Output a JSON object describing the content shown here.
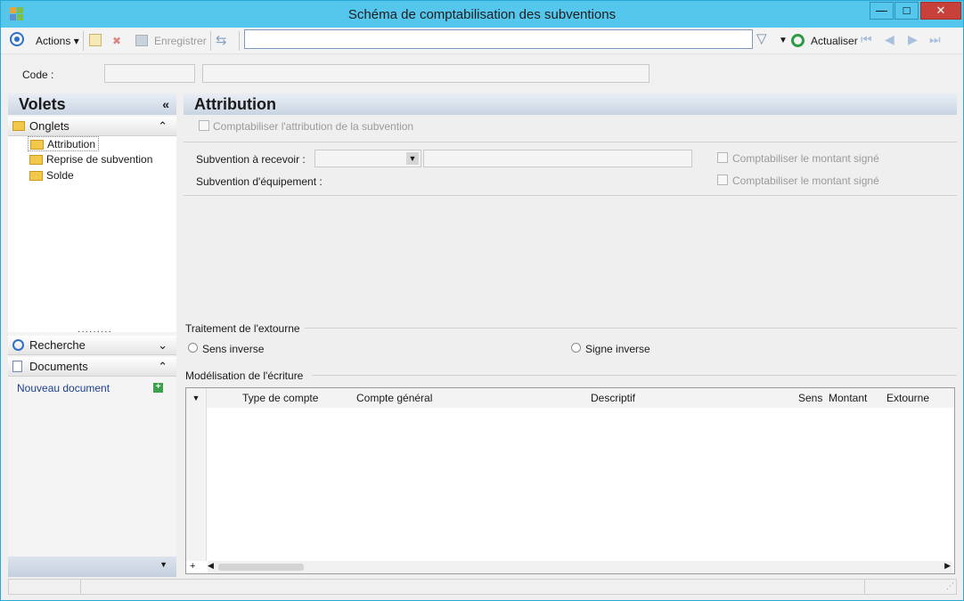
{
  "window": {
    "title": "Schéma de comptabilisation des subventions"
  },
  "toolbar": {
    "actions_label": "Actions",
    "save_label": "Enregistrer",
    "search_value": "",
    "refresh_label": "Actualiser"
  },
  "code": {
    "label": "Code :",
    "value": "",
    "description": ""
  },
  "left": {
    "title": "Volets",
    "tabs_group": "Onglets",
    "tabs": [
      "Attribution",
      "Reprise de subvention",
      "Solde"
    ],
    "search_group": "Recherche",
    "documents_group": "Documents",
    "new_document": "Nouveau document"
  },
  "main": {
    "title": "Attribution",
    "post_attribution_label": "Comptabiliser l'attribution de la subvention",
    "subsidy_receivable_label": "Subvention à recevoir :",
    "subsidy_equipment_label": "Subvention d'équipement :",
    "signed_amount_label_1": "Comptabiliser le montant signé",
    "signed_amount_label_2": "Comptabiliser le montant signé",
    "reversal_group": "Traitement de l'extourne",
    "reverse_direction": "Sens inverse",
    "reverse_sign": "Signe inverse",
    "modeling_group": "Modélisation de l'écriture",
    "grid_columns": [
      "Type de compte",
      "Compte général",
      "Descriptif",
      "Sens",
      "Montant",
      "Extourne"
    ]
  },
  "colors": {
    "titlebar": "#55c6ec",
    "close": "#c7403a",
    "header_gradient": "#c9d4e3"
  }
}
